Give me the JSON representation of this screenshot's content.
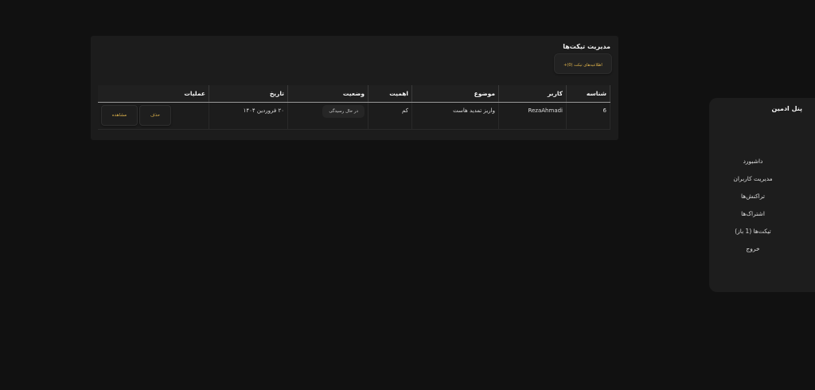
{
  "sidebar": {
    "title": "پنل ادمین",
    "items": [
      {
        "label": "داشبورد"
      },
      {
        "label": "مدیریت کاربران"
      },
      {
        "label": "تراکنش‌ها"
      },
      {
        "label": "اشتراک‌ها"
      },
      {
        "label": "تیکت‌ها (1 باز)"
      },
      {
        "label": "خروج"
      }
    ]
  },
  "main": {
    "title": "مدیریت تیکت‌ها",
    "add_button_label": "اطلاعیه‌های تیکت (0)+",
    "table": {
      "headers": [
        "شناسه",
        "کاربر",
        "موضوع",
        "اهمیت",
        "وضعیت",
        "تاریخ",
        "عملیات"
      ],
      "rows": [
        {
          "id": "6",
          "user": "RezaAhmadi",
          "subject": "واریز تمدید هاست",
          "priority": "کم",
          "status": "در حال رسیدگی",
          "date": "۲۰ فروردین ۱۴۰۴",
          "actions": {
            "view": "مشاهده",
            "delete": "حذف"
          }
        }
      ]
    }
  },
  "colors": {
    "background": "#111111",
    "panel": "#1c1c1c",
    "accent": "#e2b64c"
  }
}
